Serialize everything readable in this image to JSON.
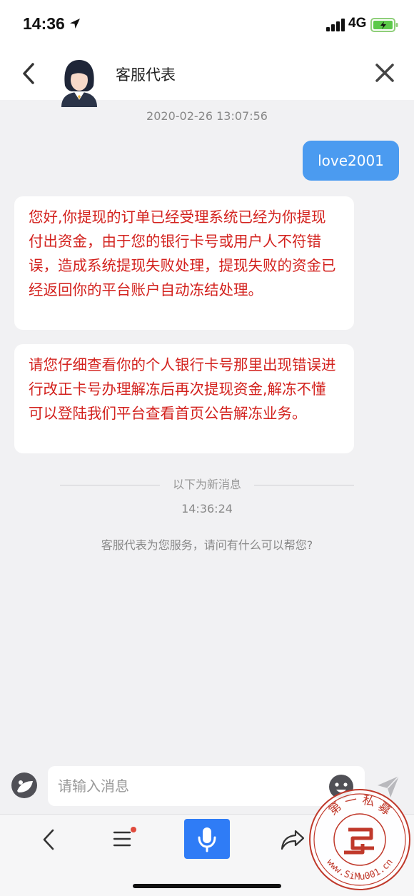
{
  "status_bar": {
    "time": "14:36",
    "network": "4G"
  },
  "header": {
    "title": "客服代表"
  },
  "chat": {
    "timestamp_top": "2020-02-26 13:07:56",
    "outgoing_message": "love2001",
    "incoming_messages": [
      "您好,你提现的订单已经受理系统已经为你提现付出资金，由于您的银行卡号或用户人不符错误，造成系统提现失败处理，提现失败的资金已经返回你的平台账户自动冻结处理。",
      "请您仔细查看你的个人银行卡号那里出现错误进行改正卡号办理解冻后再次提现资金,解冻不懂可以登陆我们平台查看首页公告解冻业务。"
    ],
    "divider_label": "以下为新消息",
    "timestamp_new": "14:36:24",
    "system_message": "客服代表为您服务，请问有什么可以帮您?"
  },
  "input": {
    "placeholder": "请输入消息",
    "value": ""
  },
  "watermark": {
    "top_text": "第 一 私 募",
    "bottom_text": "www.SiMu001.cn"
  },
  "colors": {
    "outgoing_bubble": "#4b9bf0",
    "incoming_text": "#d3221e",
    "mic_button": "#2f7cf6",
    "background": "#f1f1f3",
    "seal": "#c0392b"
  },
  "icons": {
    "back": "chevron-left-icon",
    "close": "close-icon",
    "voice": "voice-toggle-icon",
    "emoji": "emoji-icon",
    "send": "send-icon",
    "menu": "menu-icon",
    "mic": "microphone-icon",
    "share": "share-icon"
  }
}
